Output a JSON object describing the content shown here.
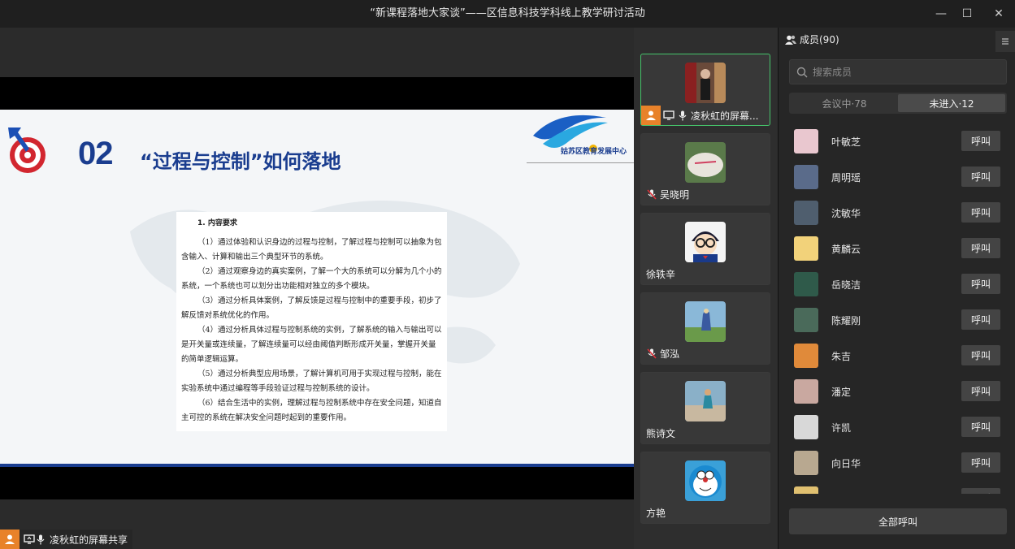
{
  "window": {
    "title": "“新课程落地大家谈”——区信息科技学科线上教学研讨活动",
    "minimize_glyph": "—",
    "maximize_glyph": "☐",
    "close_glyph": "✕"
  },
  "slide": {
    "number": "02",
    "heading": "“过程与控制”如何落地",
    "logo_text": "姑苏区教育发展中心",
    "doc_title": "1. 内容要求",
    "paragraphs": [
      "（1）通过体验和认识身边的过程与控制，了解过程与控制可以抽象为包含输入、计算和输出三个典型环节的系统。",
      "（2）通过观察身边的真实案例，了解一个大的系统可以分解为几个小的系统，一个系统也可以划分出功能相对独立的多个模块。",
      "（3）通过分析具体案例，了解反馈是过程与控制中的重要手段，初步了解反馈对系统优化的作用。",
      "（4）通过分析具体过程与控制系统的实例，了解系统的输入与输出可以是开关量或连续量，了解连续量可以经由阈值判断形成开关量，掌握开关量的简单逻辑运算。",
      "（5）通过分析典型应用场景，了解计算机可用于实现过程与控制，能在实验系统中通过编程等手段验证过程与控制系统的设计。",
      "（6）结合生活中的实例，理解过程与控制系统中存在安全问题，知道自主可控的系统在解决安全问题时起到的重要作用。"
    ]
  },
  "share_bar": {
    "label": "凌秋虹的屏幕共享"
  },
  "gallery": {
    "tiles": [
      {
        "name": "凌秋虹的屏幕...",
        "active": true
      },
      {
        "name": "吴晓明",
        "muted": true
      },
      {
        "name": "徐轶辛"
      },
      {
        "name": "邹泓",
        "muted": true
      },
      {
        "name": "熊诗文"
      },
      {
        "name": "方艳"
      }
    ]
  },
  "members_panel": {
    "header": "成员(90)",
    "search_placeholder": "搜索成员",
    "tab_in_meeting": "会议中·78",
    "tab_not_joined": "未进入·12",
    "call_label": "呼叫",
    "call_all_label": "全部呼叫",
    "members": [
      {
        "name": "叶敏芝",
        "color": "#e9c7cf"
      },
      {
        "name": "周明瑶",
        "color": "#5a6b8a"
      },
      {
        "name": "沈敏华",
        "color": "#4f5e6e"
      },
      {
        "name": "黄麟云",
        "color": "#f2d27a"
      },
      {
        "name": "岳晓洁",
        "color": "#2f5a4a"
      },
      {
        "name": "陈耀刚",
        "color": "#4a6a5a"
      },
      {
        "name": "朱吉",
        "color": "#e08a3a"
      },
      {
        "name": "潘定",
        "color": "#c9a8a0"
      },
      {
        "name": "许凯",
        "color": "#d8d8d8"
      },
      {
        "name": "向日华",
        "color": "#b8a890"
      },
      {
        "name": "",
        "color": "#e0c070"
      }
    ]
  }
}
